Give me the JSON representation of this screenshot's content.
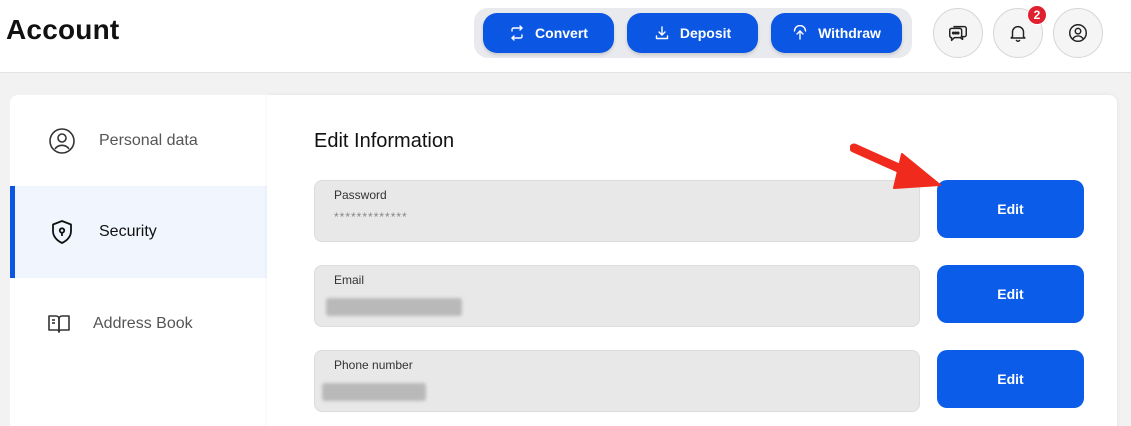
{
  "header": {
    "title": "Account",
    "actions": [
      {
        "label": "Convert",
        "icon": "convert-icon"
      },
      {
        "label": "Deposit",
        "icon": "deposit-icon"
      },
      {
        "label": "Withdraw",
        "icon": "withdraw-icon"
      }
    ],
    "notification_count": "2",
    "icons": [
      "chat-icon",
      "bell-icon",
      "user-icon"
    ]
  },
  "sidebar": {
    "items": [
      {
        "label": "Personal data",
        "icon": "user-circle-icon"
      },
      {
        "label": "Security",
        "icon": "shield-icon",
        "active": true
      },
      {
        "label": "Address Book",
        "icon": "book-icon"
      }
    ]
  },
  "main": {
    "title": "Edit Information",
    "fields": [
      {
        "label": "Password",
        "value": "*************",
        "button": "Edit"
      },
      {
        "label": "Email",
        "value": "",
        "button": "Edit"
      },
      {
        "label": "Phone number",
        "value": "",
        "button": "Edit"
      }
    ]
  },
  "colors": {
    "primary": "#0b57e3",
    "badge": "#e0202f",
    "annotation_arrow": "#f02a1c"
  }
}
